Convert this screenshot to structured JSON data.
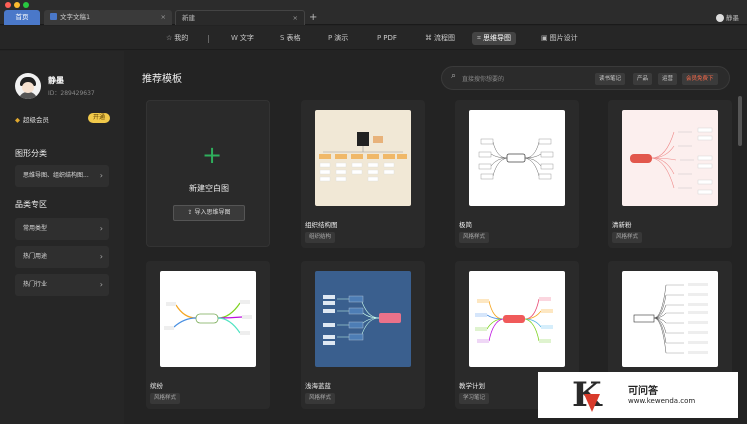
{
  "titlebar": {
    "tabs": [
      {
        "label": "首页",
        "active": true
      },
      {
        "label": "文字文稿1"
      },
      {
        "label": "新建"
      }
    ],
    "add_label": "+",
    "close_glyph": "×",
    "user": "静墨"
  },
  "navbar": {
    "items": [
      {
        "icon": "☆",
        "label": "我的"
      },
      {
        "icon": "W",
        "label": "文字"
      },
      {
        "icon": "S",
        "label": "表格"
      },
      {
        "icon": "P",
        "label": "演示"
      },
      {
        "icon": "P",
        "label": "PDF"
      },
      {
        "icon": "⌘",
        "label": "流程图"
      },
      {
        "icon": "⌗",
        "label": "思维导图",
        "active": true
      },
      {
        "icon": "▣",
        "label": "图片设计"
      }
    ]
  },
  "sidebar": {
    "username": "静墨",
    "user_id": "ID：289429637",
    "vip_label": "超级会员",
    "open_label": "开通",
    "sec_category": "图形分类",
    "category_items": [
      "思维导图、组织结构图..."
    ],
    "sec_zone": "品类专区",
    "zone_items": [
      "常用类型",
      "热门用途",
      "热门行业"
    ],
    "chevron": "›"
  },
  "main": {
    "title": "推荐模板",
    "search_placeholder": "直接搜你想要的",
    "search_icon": "⌕",
    "chips": [
      "读书笔记",
      "产品",
      "运营",
      "会员免费下"
    ],
    "blank_card": {
      "plus": "+",
      "label": "新建空白图",
      "import_icon": "⇪",
      "import": "导入思维导图"
    },
    "templates": [
      {
        "name": "组织结构图",
        "tag": "组织结构",
        "thumb": "org"
      },
      {
        "name": "极简",
        "tag": "风格样式",
        "thumb": "simple"
      },
      {
        "name": "清新粉",
        "tag": "风格样式",
        "thumb": "pink"
      },
      {
        "name": "缤纷",
        "tag": "风格样式",
        "thumb": "colorful"
      },
      {
        "name": "浅海蓝蓝",
        "tag": "风格样式",
        "thumb": "blue"
      },
      {
        "name": "教学计划",
        "tag": "学习笔记",
        "thumb": "plan"
      },
      {
        "name": "",
        "tag": "",
        "thumb": "list"
      }
    ]
  },
  "watermark": {
    "letter": "K",
    "cn": "可问答",
    "url": "www.kewenda.com"
  },
  "colors": {
    "accent": "#4a78c9",
    "green": "#2fae5c",
    "vip": "#f1c94a",
    "hot": "#ff6b4a"
  }
}
